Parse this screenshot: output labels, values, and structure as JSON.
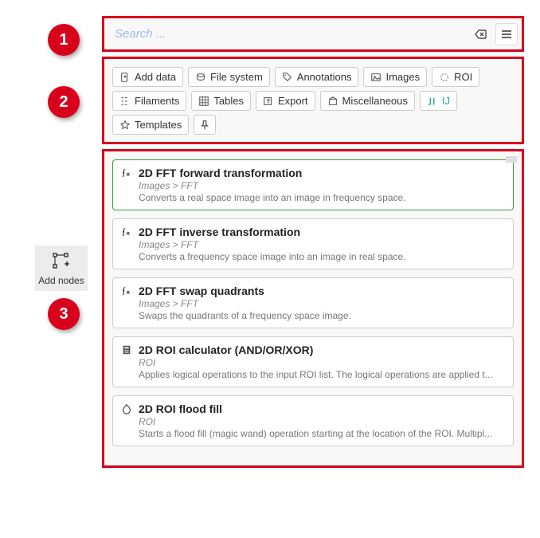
{
  "search": {
    "placeholder": "Search ..."
  },
  "badges": {
    "b1": "1",
    "b2": "2",
    "b3": "3"
  },
  "sideTab": {
    "label": "Add nodes"
  },
  "categories": {
    "row1": [
      {
        "id": "add-data",
        "label": "Add data",
        "icon": "doc-plus"
      },
      {
        "id": "file-system",
        "label": "File system",
        "icon": "disk"
      },
      {
        "id": "annotations",
        "label": "Annotations",
        "icon": "tag"
      },
      {
        "id": "images",
        "label": "Images",
        "icon": "image"
      },
      {
        "id": "roi",
        "label": "ROI",
        "icon": "roi"
      }
    ],
    "row2": [
      {
        "id": "filaments",
        "label": "Filaments",
        "icon": "filament"
      },
      {
        "id": "tables",
        "label": "Tables",
        "icon": "grid"
      },
      {
        "id": "export",
        "label": "Export",
        "icon": "export"
      },
      {
        "id": "miscellaneous",
        "label": "Miscellaneous",
        "icon": "box"
      },
      {
        "id": "ij",
        "label": "IJ",
        "icon": "ij"
      }
    ],
    "row3": [
      {
        "id": "templates",
        "label": "Templates",
        "icon": "star"
      },
      {
        "id": "pin",
        "label": "",
        "icon": "pin"
      }
    ]
  },
  "results": [
    {
      "icon": "fx",
      "title": "2D FFT forward transformation",
      "path": "Images > FFT",
      "desc": "Converts a real space image into an image in frequency space.",
      "selected": true
    },
    {
      "icon": "fx",
      "title": "2D FFT inverse transformation",
      "path": "Images > FFT",
      "desc": "Converts a frequency space image into an image in real space."
    },
    {
      "icon": "fx",
      "title": "2D FFT swap quadrants",
      "path": "Images > FFT",
      "desc": "Swaps the quadrants of a frequency space image."
    },
    {
      "icon": "calc",
      "title": "2D ROI calculator (AND/OR/XOR)",
      "path": "ROI",
      "desc": "Applies logical operations to the input ROI list. The logical operations are applied t..."
    },
    {
      "icon": "flood",
      "title": "2D ROI flood fill",
      "path": "ROI",
      "desc": "Starts a flood fill (magic wand) operation starting at the location of the ROI. Multipl..."
    }
  ]
}
